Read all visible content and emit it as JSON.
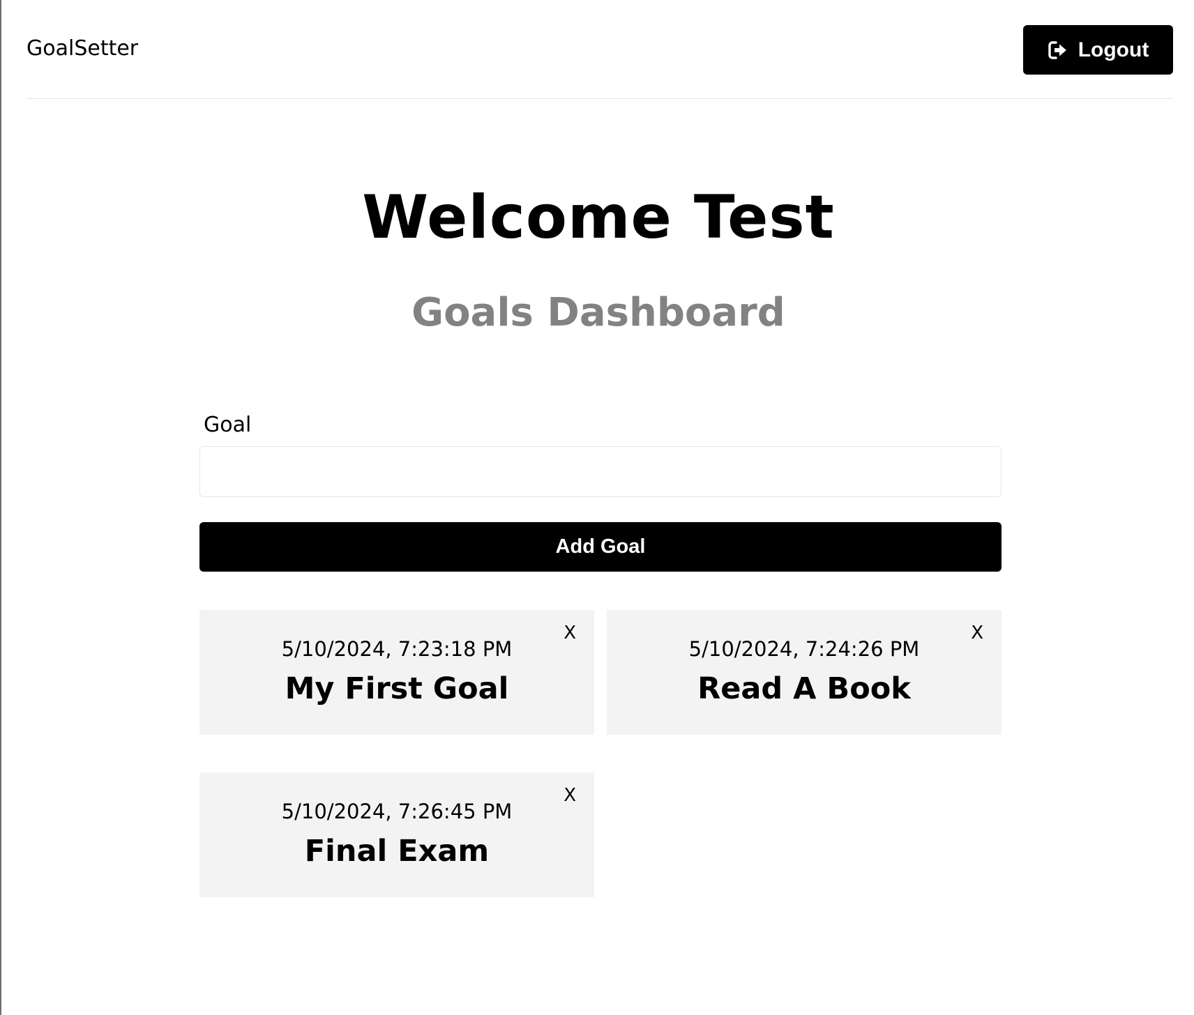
{
  "header": {
    "brand": "GoalSetter",
    "logout_label": "Logout",
    "logout_icon": "sign-out-icon"
  },
  "main": {
    "welcome": "Welcome Test",
    "subtitle": "Goals Dashboard"
  },
  "form": {
    "label": "Goal",
    "input_value": "",
    "submit_label": "Add Goal"
  },
  "goals": [
    {
      "date": "5/10/2024, 7:23:18 PM",
      "text": "My First Goal",
      "delete_label": "X"
    },
    {
      "date": "5/10/2024, 7:24:26 PM",
      "text": "Read A Book",
      "delete_label": "X"
    },
    {
      "date": "5/10/2024, 7:26:45 PM",
      "text": "Final Exam",
      "delete_label": "X"
    }
  ],
  "colors": {
    "primary": "#000000",
    "subtitle": "#828282",
    "card_bg": "#f3f3f3",
    "divider": "#e6e6e6"
  }
}
